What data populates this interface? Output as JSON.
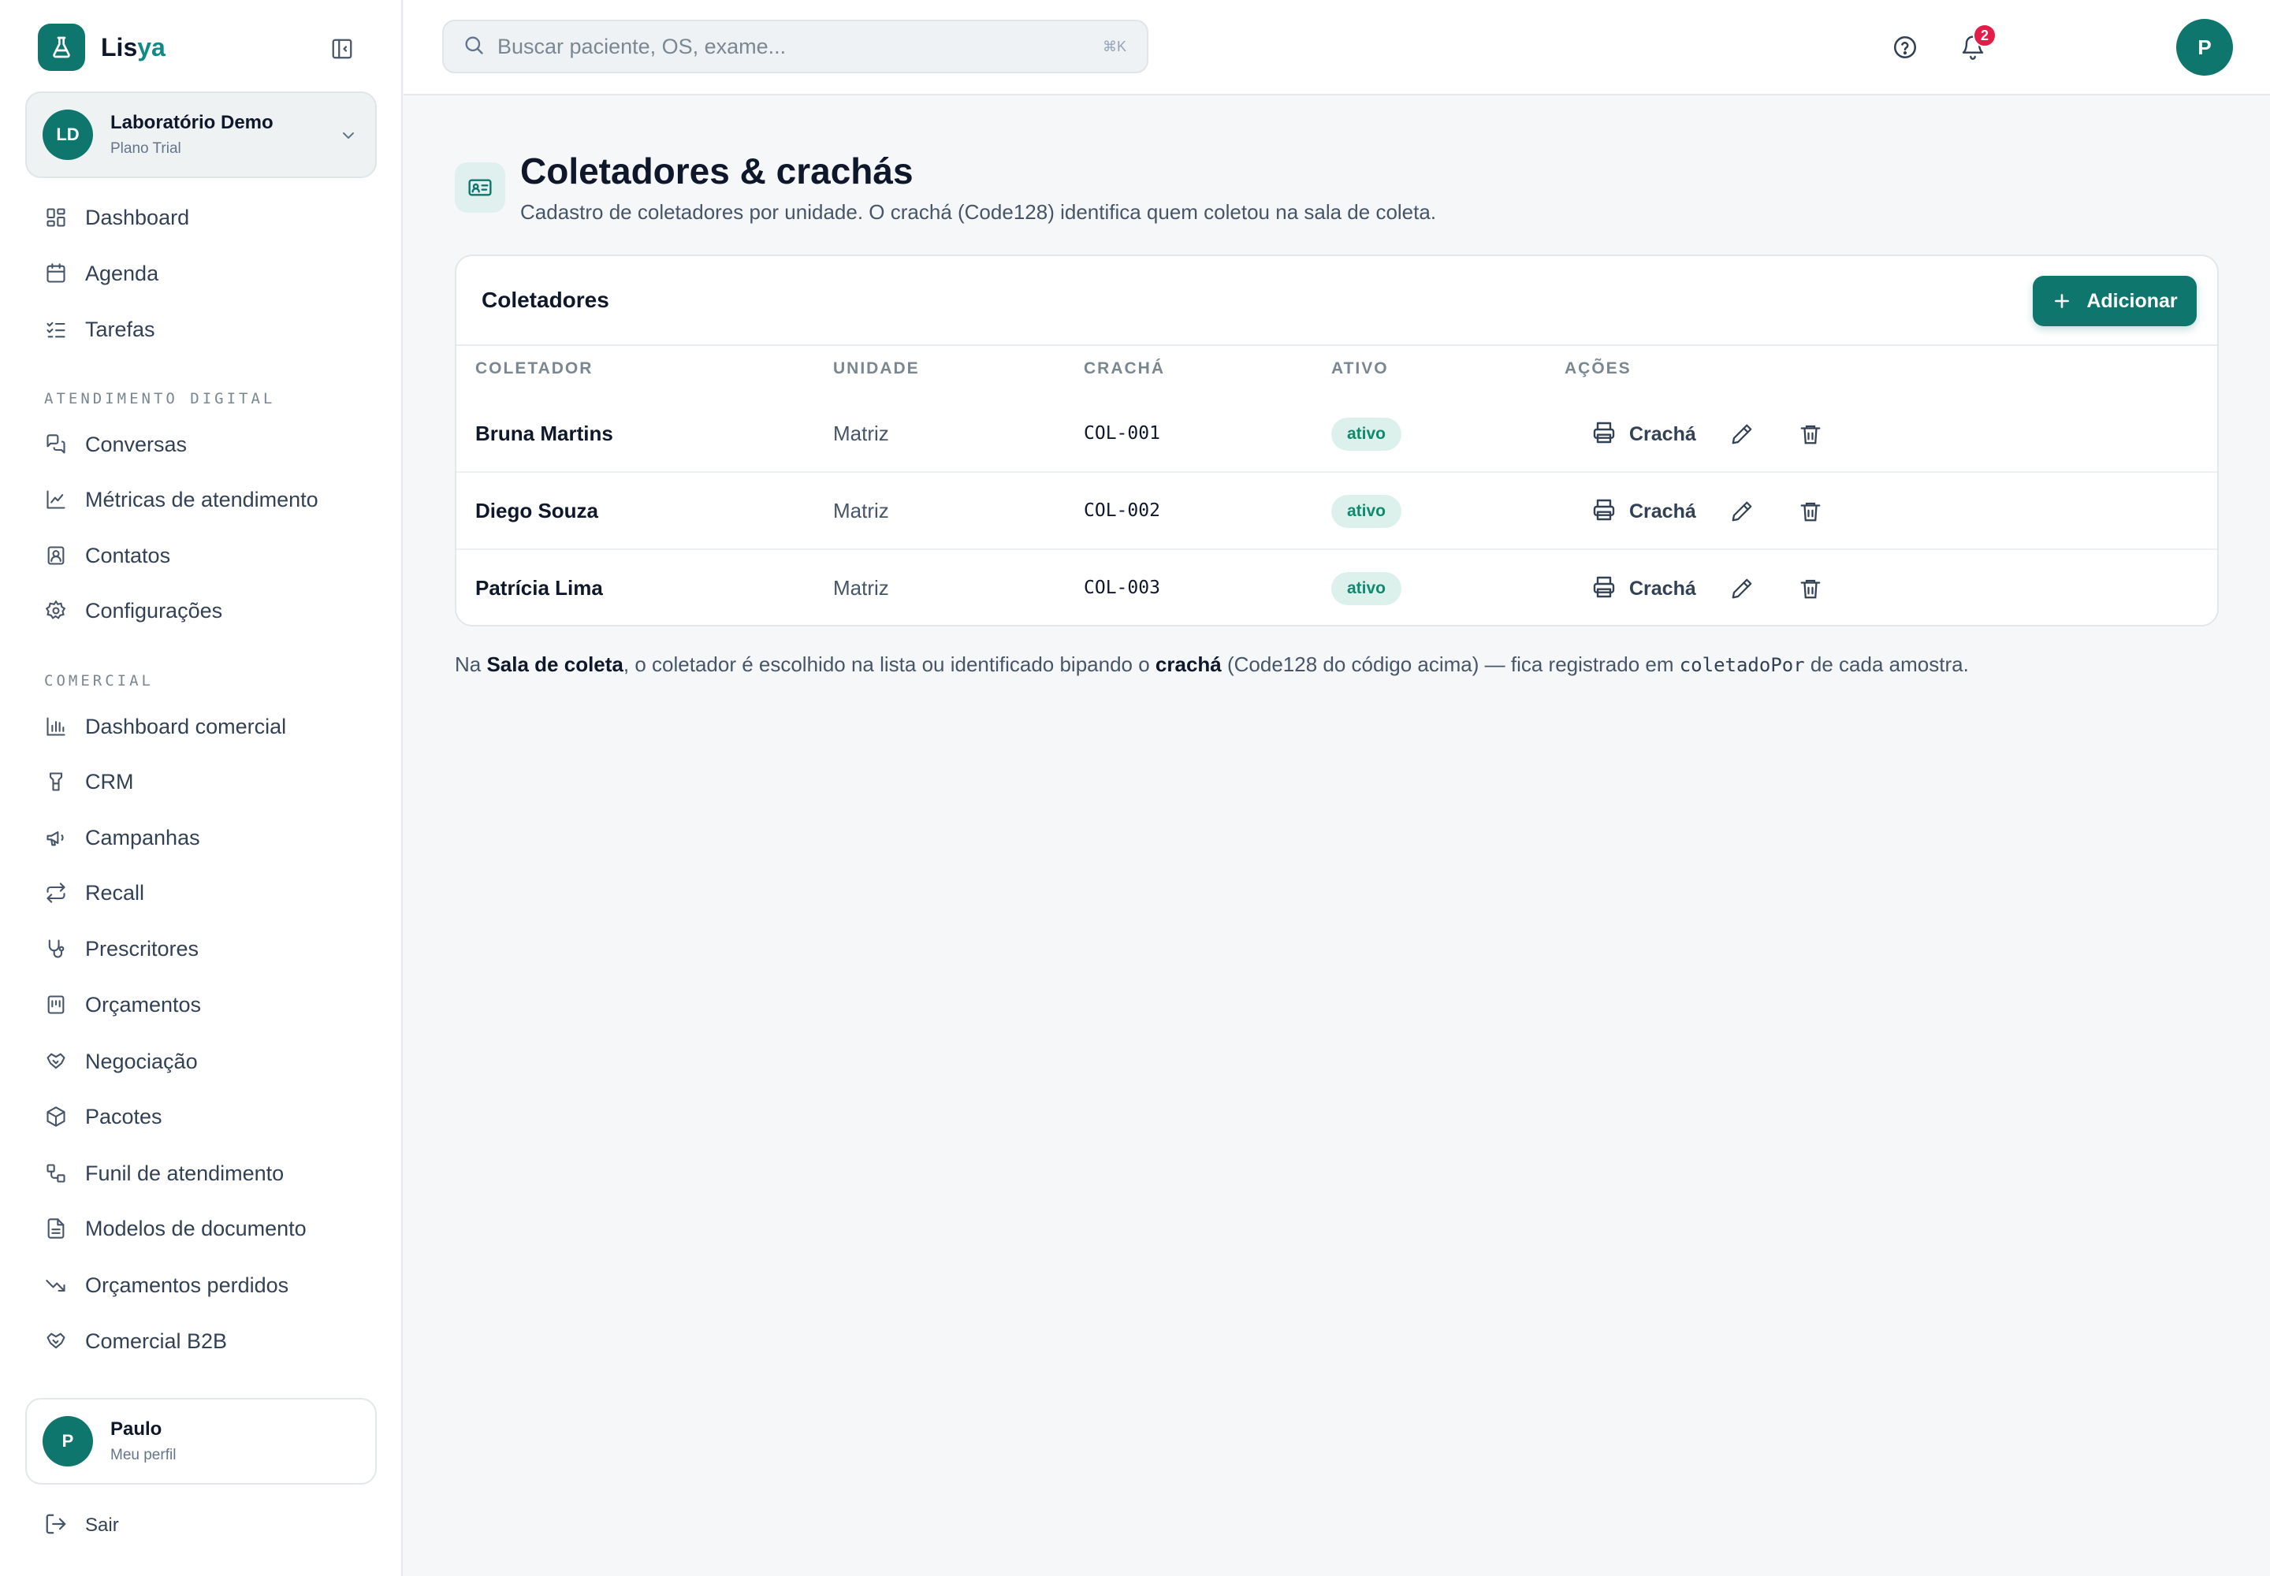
{
  "brand": {
    "name_a": "Lis",
    "name_b": "ya"
  },
  "org": {
    "initials": "LD",
    "name": "Laboratório Demo",
    "plan": "Plano Trial"
  },
  "nav": {
    "top": [
      {
        "label": "Dashboard",
        "icon": "dashboard-icon"
      },
      {
        "label": "Agenda",
        "icon": "calendar-icon"
      },
      {
        "label": "Tarefas",
        "icon": "checklist-icon"
      }
    ],
    "section_digital": "ATENDIMENTO DIGITAL",
    "digital": [
      {
        "label": "Conversas",
        "icon": "chat-icon"
      },
      {
        "label": "Métricas de atendimento",
        "icon": "line-chart-icon"
      },
      {
        "label": "Contatos",
        "icon": "contacts-icon"
      },
      {
        "label": "Configurações",
        "icon": "gear-icon"
      }
    ],
    "section_comercial": "COMERCIAL",
    "comercial": [
      {
        "label": "Dashboard comercial",
        "icon": "bar-chart-icon"
      },
      {
        "label": "CRM",
        "icon": "crm-icon"
      },
      {
        "label": "Campanhas",
        "icon": "megaphone-icon"
      },
      {
        "label": "Recall",
        "icon": "repeat-icon"
      },
      {
        "label": "Prescritores",
        "icon": "stethoscope-icon"
      },
      {
        "label": "Orçamentos",
        "icon": "receipt-icon"
      },
      {
        "label": "Negociação",
        "icon": "handshake-icon"
      },
      {
        "label": "Pacotes",
        "icon": "package-icon"
      },
      {
        "label": "Funil de atendimento",
        "icon": "workflow-icon"
      },
      {
        "label": "Modelos de documento",
        "icon": "document-icon"
      },
      {
        "label": "Orçamentos perdidos",
        "icon": "trending-down-icon"
      },
      {
        "label": "Comercial B2B",
        "icon": "handshake-icon"
      }
    ]
  },
  "user": {
    "initial": "P",
    "name": "Paulo",
    "sub": "Meu perfil"
  },
  "logout_label": "Sair",
  "search": {
    "placeholder": "Buscar paciente, OS, exame...",
    "value": "",
    "shortcut": "⌘K"
  },
  "notifications": {
    "count": "2"
  },
  "top_avatar": "P",
  "page": {
    "title": "Coletadores & crachás",
    "subtitle": "Cadastro de coletadores por unidade. O crachá (Code128) identifica quem coletou na sala de coleta."
  },
  "card": {
    "title": "Coletadores",
    "add_label": "Adicionar",
    "columns": [
      "COLETADOR",
      "UNIDADE",
      "CRACHÁ",
      "ATIVO",
      "AÇÕES"
    ],
    "badge_action_label": "Crachá",
    "rows": [
      {
        "name": "Bruna Martins",
        "unit": "Matriz",
        "code": "COL-001",
        "status": "ativo"
      },
      {
        "name": "Diego Souza",
        "unit": "Matriz",
        "code": "COL-002",
        "status": "ativo"
      },
      {
        "name": "Patrícia Lima",
        "unit": "Matriz",
        "code": "COL-003",
        "status": "ativo"
      }
    ]
  },
  "footnote": {
    "p1": "Na ",
    "b1": "Sala de coleta",
    "p2": ", o coletador é escolhido na lista ou identificado bipando o ",
    "b2": "crachá",
    "p3": " (Code128 do código acima) — fica registrado em ",
    "code": "coletadoPor",
    "p4": " de cada amostra."
  },
  "colors": {
    "accent": "#0f766e",
    "status_bg": "#dcf1ec",
    "status_text": "#0f8a6f",
    "badge": "#e11d48"
  }
}
